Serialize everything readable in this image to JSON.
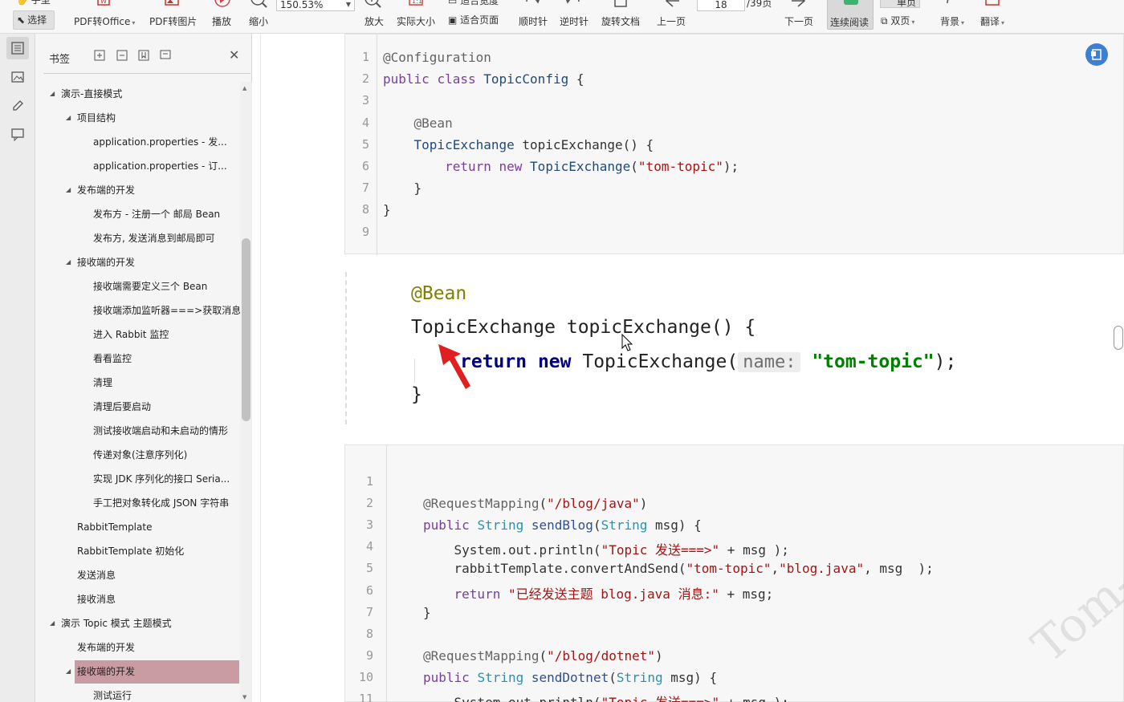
{
  "toolbar": {
    "hand_label": "手型",
    "select_label": "选择",
    "pdf_to_office": "PDF转Office",
    "pdf_to_image": "PDF转图片",
    "play": "播放",
    "zoom_out": "缩小",
    "zoom_value": "150.53%",
    "zoom_in": "放大",
    "actual_size": "实际大小",
    "fit_width": "适合宽度",
    "fit_page": "适合页面",
    "rotate_cw": "顺时针",
    "rotate_ccw": "逆时针",
    "rotate_doc": "旋转文档",
    "prev_page": "上一页",
    "page_current": "18",
    "page_total": "/39页",
    "next_page": "下一页",
    "continuous": "连续阅读",
    "single": "单页",
    "double": "双页",
    "background": "背景",
    "translate": "翻译"
  },
  "bookmarks": {
    "title": "书签",
    "items": [
      {
        "label": "演示-直接模式",
        "level": 0,
        "expanded": true
      },
      {
        "label": "项目结构",
        "level": 1,
        "expanded": true
      },
      {
        "label": "application.properties   - 发...",
        "level": 2
      },
      {
        "label": "application.properties   - 订...",
        "level": 2
      },
      {
        "label": "发布端的开发",
        "level": 1,
        "expanded": true
      },
      {
        "label": "发布方 - 注册一个 邮局 Bean",
        "level": 2
      },
      {
        "label": "发布方, 发送消息到邮局即可",
        "level": 2
      },
      {
        "label": "接收端的开发",
        "level": 1,
        "expanded": true
      },
      {
        "label": "接收端需要定义三个 Bean",
        "level": 2
      },
      {
        "label": "接收端添加监听器===>获取消息",
        "level": 2
      },
      {
        "label": "进入 Rabbit 监控",
        "level": 2
      },
      {
        "label": "看看监控",
        "level": 2
      },
      {
        "label": "清理",
        "level": 2
      },
      {
        "label": "清理后要启动",
        "level": 2
      },
      {
        "label": "测试接收端启动和未启动的情形",
        "level": 2
      },
      {
        "label": "传递对象(注意序列化)",
        "level": 2
      },
      {
        "label": "实现 JDK  序列化的接口   Seria...",
        "level": 2
      },
      {
        "label": "手工把对象转化成 JSON 字符串",
        "level": 2
      },
      {
        "label": "RabbitTemplate",
        "level": 1
      },
      {
        "label": "RabbitTemplate 初始化",
        "level": 1
      },
      {
        "label": "发送消息",
        "level": 1
      },
      {
        "label": "接收消息",
        "level": 1
      },
      {
        "label": "演示 Topic 模式 主题模式",
        "level": 0,
        "expanded": true
      },
      {
        "label": "发布端的开发",
        "level": 1
      },
      {
        "label": "接收端的开发",
        "level": 1,
        "expanded": true,
        "selected": true
      },
      {
        "label": "测试运行",
        "level": 2
      }
    ]
  },
  "code_block_1": {
    "lines": [
      {
        "n": "1",
        "t": "@Configuration"
      },
      {
        "n": "2",
        "t": "public class TopicConfig {"
      },
      {
        "n": "3",
        "t": ""
      },
      {
        "n": "4",
        "t": "    @Bean"
      },
      {
        "n": "5",
        "t": "    TopicExchange topicExchange() {"
      },
      {
        "n": "6",
        "t": "        return new TopicExchange(\"tom-topic\");"
      },
      {
        "n": "7",
        "t": "    }"
      },
      {
        "n": "8",
        "t": "}"
      },
      {
        "n": "9",
        "t": ""
      }
    ]
  },
  "ide_snippet": {
    "line1": "@Bean",
    "line2": "TopicExchange topicExchange() {",
    "line3_kw1": "return",
    "line3_kw2": "new",
    "line3_cls": " TopicExchange(",
    "line3_hint": "name:",
    "line3_str": "\"tom-topic\"",
    "line3_end": ");",
    "line4": "}"
  },
  "code_block_2": {
    "lines": [
      {
        "n": "1",
        "t": ""
      },
      {
        "n": "2",
        "t": "@RequestMapping(\"/blog/java\")"
      },
      {
        "n": "3",
        "t": "public String sendBlog(String msg) {"
      },
      {
        "n": "4",
        "t": "    System.out.println(\"Topic 发送===>\" + msg );"
      },
      {
        "n": "5",
        "t": "    rabbitTemplate.convertAndSend(\"tom-topic\",\"blog.java\", msg  );"
      },
      {
        "n": "6",
        "t": "    return \"已经发送主题 blog.java 消息:\" + msg;"
      },
      {
        "n": "7",
        "t": "}"
      },
      {
        "n": "8",
        "t": ""
      },
      {
        "n": "9",
        "t": "@RequestMapping(\"/blog/dotnet\")"
      },
      {
        "n": "10",
        "t": "public String sendDotnet(String msg) {"
      },
      {
        "n": "11",
        "t": "    System.out.println(\"Topic 发送===>\" + msg );"
      }
    ]
  },
  "watermark": "Tom-一点",
  "colors": {
    "selected_bookmark": "#c99ba2",
    "continuous_active": "#d9d9d9",
    "float_button": "#3d7fd3",
    "arrow_red": "#e02020"
  }
}
